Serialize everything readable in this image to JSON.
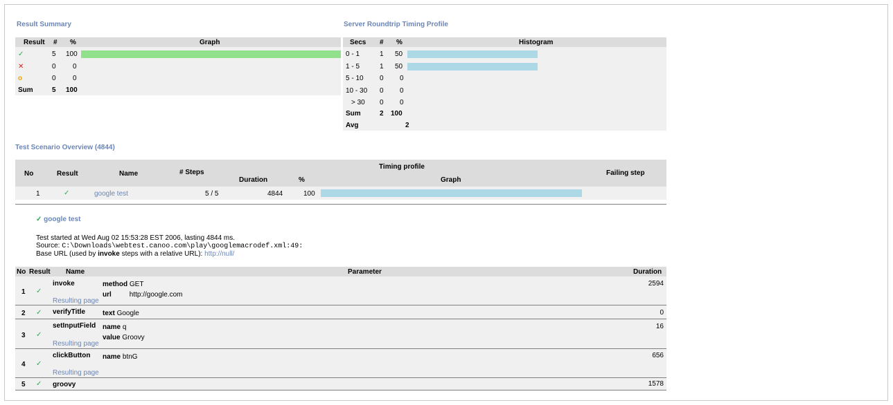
{
  "result_summary": {
    "title": "Result Summary",
    "headers": {
      "result": "Result",
      "count": "#",
      "pct": "%",
      "graph": "Graph"
    },
    "rows": [
      {
        "icon": "check-icon",
        "glyph": "✓",
        "count": "5",
        "pct": "100",
        "bar": 1.0
      },
      {
        "icon": "cross-icon",
        "glyph": "✕",
        "count": "0",
        "pct": "0",
        "bar": 0
      },
      {
        "icon": "circle-icon",
        "glyph": "o",
        "count": "0",
        "pct": "0",
        "bar": 0
      }
    ],
    "sum": {
      "label": "Sum",
      "count": "5",
      "pct": "100"
    }
  },
  "timing_profile": {
    "title": "Server Roundtrip Timing Profile",
    "headers": {
      "secs": "Secs",
      "count": "#",
      "pct": "%",
      "histogram": "Histogram"
    },
    "rows": [
      {
        "secs": "0 - 1",
        "count": "1",
        "pct": "50",
        "bar": 0.5
      },
      {
        "secs": "1 - 5",
        "count": "1",
        "pct": "50",
        "bar": 0.5
      },
      {
        "secs": "5 - 10",
        "count": "0",
        "pct": "0",
        "bar": 0
      },
      {
        "secs": "10 - 30",
        "count": "0",
        "pct": "0",
        "bar": 0
      },
      {
        "secs": "> 30",
        "count": "0",
        "pct": "0",
        "bar": 0
      }
    ],
    "sum": {
      "label": "Sum",
      "count": "2",
      "pct": "100"
    },
    "avg": {
      "label": "Avg",
      "value": "2"
    }
  },
  "overview": {
    "title": "Test Scenario Overview (4844)",
    "headers": {
      "no": "No",
      "result": "Result",
      "name": "Name",
      "steps": "# Steps",
      "timing": "Timing profile",
      "duration": "Duration",
      "pct": "%",
      "graph": "Graph",
      "failing": "Failing step"
    },
    "row": {
      "no": "1",
      "glyph": "✓",
      "name": "google test",
      "steps": "5 / 5",
      "duration": "4844",
      "pct": "100",
      "bar": 1.0,
      "failing": ""
    }
  },
  "detail": {
    "title_glyph": "✓",
    "title": "google test",
    "started": "Test started at Wed Aug 02 15:53:28 EST 2006, lasting 4844 ms.",
    "source_label": "Source:",
    "source_path": "C:\\Downloads\\webtest.canoo.com\\play\\googlemacrodef.xml:49:",
    "base_url_pre": "Base URL (used by ",
    "base_url_bold": "invoke",
    "base_url_post": " steps with a relative URL):",
    "base_url_link": "http://null/"
  },
  "steps": {
    "headers": {
      "no": "No",
      "result": "Result",
      "name": "Name",
      "parameter": "Parameter",
      "duration": "Duration"
    },
    "resulting_page": "Resulting page",
    "rows": [
      {
        "no": "1",
        "glyph": "✓",
        "name": "invoke",
        "params": [
          {
            "k": "method",
            "v": "GET"
          },
          {
            "k": "url",
            "v": "http://google.com"
          }
        ],
        "duration": "2594",
        "resulting": true
      },
      {
        "no": "2",
        "glyph": "✓",
        "name": "verifyTitle",
        "params": [
          {
            "k": "text",
            "v": "Google"
          }
        ],
        "duration": "0",
        "resulting": false
      },
      {
        "no": "3",
        "glyph": "✓",
        "name": "setInputField",
        "params": [
          {
            "k": "name",
            "v": "q"
          },
          {
            "k": "value",
            "v": "Groovy"
          }
        ],
        "duration": "16",
        "resulting": true
      },
      {
        "no": "4",
        "glyph": "✓",
        "name": "clickButton",
        "params": [
          {
            "k": "name",
            "v": "btnG"
          }
        ],
        "duration": "656",
        "resulting": true
      },
      {
        "no": "5",
        "glyph": "✓",
        "name": "groovy",
        "params": [],
        "duration": "1578",
        "resulting": false
      }
    ]
  },
  "colors": {
    "accent": "#6b86b7",
    "ok": "#2fa84f",
    "fail": "#e02020",
    "warn": "#f0a500",
    "bar_green": "#90e08c",
    "bar_blue": "#add8e6"
  }
}
